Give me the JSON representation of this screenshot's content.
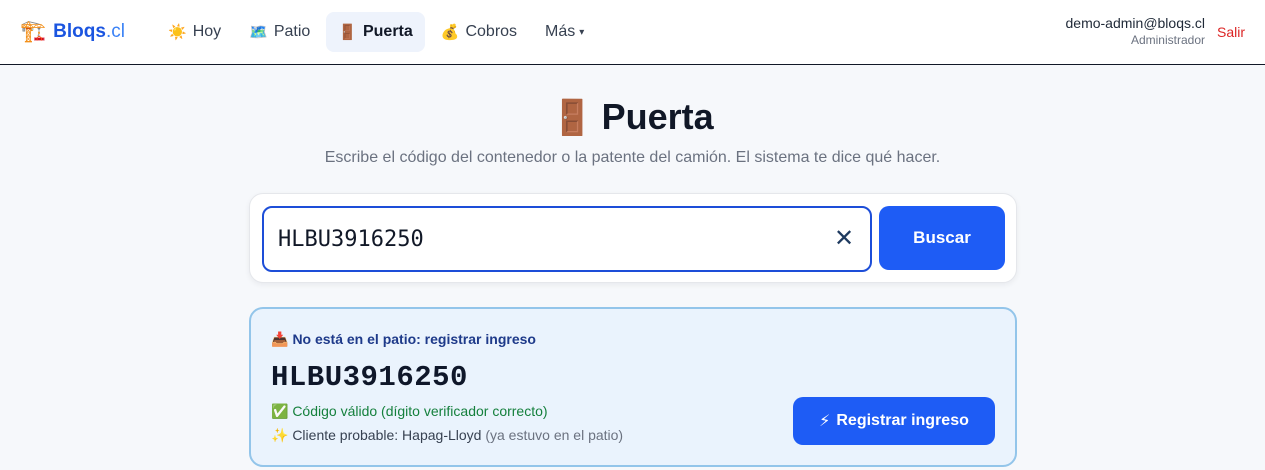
{
  "brand": {
    "icon": "🏗️",
    "name": "Bloqs",
    "tld": ".cl"
  },
  "nav": {
    "items": [
      {
        "icon": "☀️",
        "label": "Hoy"
      },
      {
        "icon": "🗺️",
        "label": "Patio"
      },
      {
        "icon": "🚪",
        "label": "Puerta",
        "active": true
      },
      {
        "icon": "💰",
        "label": "Cobros"
      }
    ],
    "more_label": "Más",
    "more_caret": "▾"
  },
  "user": {
    "email": "demo-admin@bloqs.cl",
    "role": "Administrador",
    "logout_label": "Salir"
  },
  "page": {
    "icon": "🚪",
    "title": "Puerta",
    "subtitle": "Escribe el código del contenedor o la patente del camión. El sistema te dice qué hacer."
  },
  "search": {
    "value": "HLBU3916250",
    "clear_glyph": "✕",
    "button_label": "Buscar"
  },
  "result": {
    "status_icon": "📥",
    "status_text": "No está en el patio: registrar ingreso",
    "code": "HLBU3916250",
    "valid_text": "✅ Código válido (dígito verificador correcto)",
    "client_prefix": "✨ Cliente probable: Hapag-Lloyd",
    "client_note": "(ya estuvo en el patio)",
    "button_icon": "⚡",
    "button_label": "Registrar ingreso"
  },
  "colors": {
    "accent": "#1e5cf5",
    "brand": "#1b55e0",
    "logout": "#dc2626",
    "valid": "#15803d",
    "result_bg": "#eaf3fd",
    "result_border": "#93c5ea"
  }
}
